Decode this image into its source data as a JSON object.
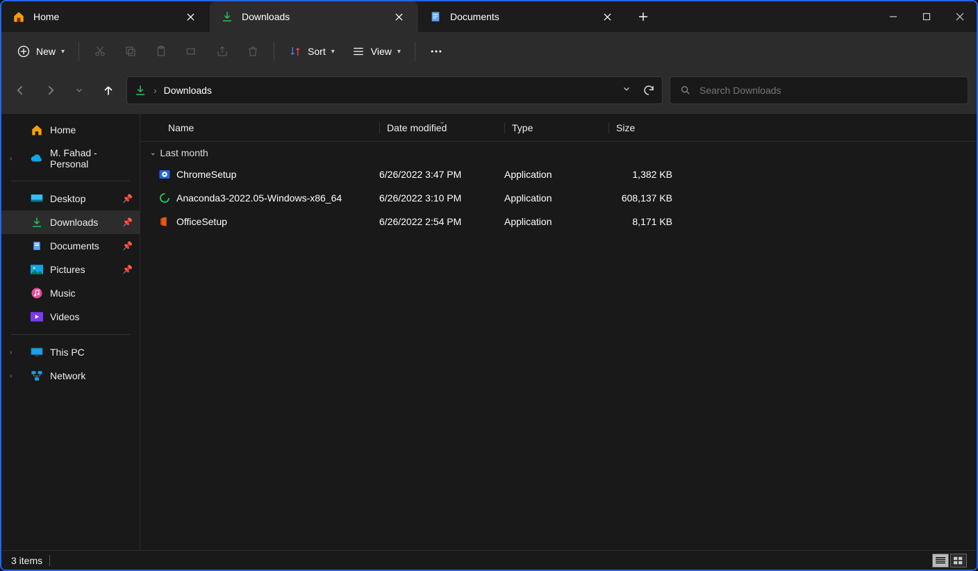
{
  "tabs": [
    {
      "label": "Home",
      "icon": "home"
    },
    {
      "label": "Downloads",
      "icon": "download"
    },
    {
      "label": "Documents",
      "icon": "document"
    }
  ],
  "toolbar": {
    "new_label": "New",
    "sort_label": "Sort",
    "view_label": "View"
  },
  "address": {
    "location": "Downloads"
  },
  "search": {
    "placeholder": "Search Downloads"
  },
  "sidebar": {
    "home": "Home",
    "onedrive": "M. Fahad - Personal",
    "quick": [
      {
        "label": "Desktop",
        "pinned": true
      },
      {
        "label": "Downloads",
        "pinned": true,
        "active": true
      },
      {
        "label": "Documents",
        "pinned": true
      },
      {
        "label": "Pictures",
        "pinned": true
      },
      {
        "label": "Music",
        "pinned": false
      },
      {
        "label": "Videos",
        "pinned": false
      }
    ],
    "thispc": "This PC",
    "network": "Network"
  },
  "columns": {
    "name": "Name",
    "date": "Date modified",
    "type": "Type",
    "size": "Size"
  },
  "group_label": "Last month",
  "files": [
    {
      "name": "ChromeSetup",
      "date": "6/26/2022 3:47 PM",
      "type": "Application",
      "size": "1,382 KB",
      "icon": "chrome"
    },
    {
      "name": "Anaconda3-2022.05-Windows-x86_64",
      "date": "6/26/2022 3:10 PM",
      "type": "Application",
      "size": "608,137 KB",
      "icon": "anaconda"
    },
    {
      "name": "OfficeSetup",
      "date": "6/26/2022 2:54 PM",
      "type": "Application",
      "size": "8,171 KB",
      "icon": "office"
    }
  ],
  "status": {
    "item_count": "3 items"
  }
}
